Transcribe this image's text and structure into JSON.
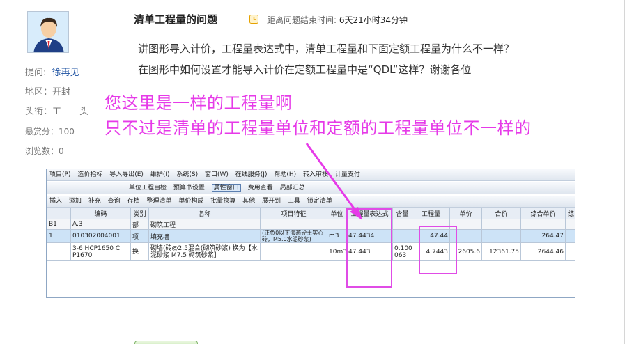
{
  "question": {
    "title": "清单工程量的问题",
    "timer_label": "距离问题结束时间:",
    "timer_value": "6天21小时34分钟",
    "body_line1": "讲图形导入计价，工程量表达式中，清单工程量和下面定额工程量为什么不一样？",
    "body_line2": "在图形中如何设置才能导入计价在定额工程量中是“QDL”这样？谢谢各位"
  },
  "asker": {
    "asker_label": "提问:",
    "asker_name": "徐再见",
    "region": "地区：开封",
    "rank": "头衔：工　　头",
    "bounty": "悬赏分：100",
    "views": "浏览数：0"
  },
  "annotation": {
    "line1": "您这里是一样的工程量啊",
    "line2": "只不过是清单的工程量单位和定额的工程量单位不一样的",
    "color": "#e63ae8"
  },
  "app": {
    "menu": [
      "项目(P)",
      "造价指标",
      "导入导出(E)",
      "维护(I)",
      "系统(S)",
      "窗口(W)",
      "在线服务(J)",
      "帮助(H)",
      "转入审核",
      "计量支付"
    ],
    "toolbar2": [
      "单位工程自检",
      "预算书设置",
      "属性窗口",
      "费用查看",
      "局部汇总"
    ],
    "toolbar3": [
      "插入",
      "添加",
      "补充",
      "查询",
      "存档",
      "整理清单",
      "单价构成",
      "批量换算",
      "其他",
      "展开到",
      "工具",
      "锁定清单"
    ],
    "headers": [
      "",
      "编码",
      "类别",
      "名称",
      "项目特征",
      "单位",
      "工程量表达式",
      "含量",
      "工程量",
      "单价",
      "合价",
      "综合单价",
      "综"
    ],
    "rows": [
      [
        "B1",
        "A.3",
        "部",
        "砌筑工程",
        "",
        "",
        "",
        "",
        "",
        "",
        "",
        "",
        ""
      ],
      [
        "1",
        "010302004001",
        "项",
        "填充墙",
        "(正负0以下海燕砼土实心砖，M5.0水泥砂浆)",
        "m3",
        "47.4434",
        "",
        "47.44",
        "",
        "",
        "264.47",
        ""
      ],
      [
        "",
        "3-6 HCP1650 C P1670",
        "换",
        "砌墙(砖@2.5混合(砌筑砂浆) 换为【水泥砂浆 M7.5 砌筑砂浆】",
        "",
        "10m3",
        "47.443",
        "0.1000 063",
        "4.7443",
        "2605.6",
        "12361.75",
        "2644.46",
        ""
      ]
    ]
  }
}
